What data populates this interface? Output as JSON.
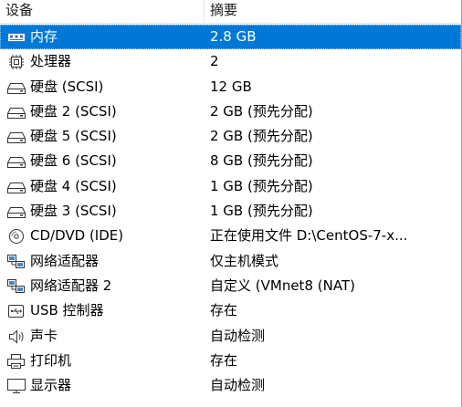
{
  "header": {
    "device": "设备",
    "summary": "摘要"
  },
  "rows": [
    {
      "device": "内存",
      "summary": "2.8 GB",
      "icon": "memory-icon",
      "selected": true
    },
    {
      "device": "处理器",
      "summary": "2",
      "icon": "cpu-icon"
    },
    {
      "device": "硬盘 (SCSI)",
      "summary": "12 GB",
      "icon": "hard-disk-icon"
    },
    {
      "device": "硬盘 2 (SCSI)",
      "summary": "2 GB (预先分配)",
      "icon": "hard-disk-icon"
    },
    {
      "device": "硬盘 5 (SCSI)",
      "summary": "2 GB (预先分配)",
      "icon": "hard-disk-icon"
    },
    {
      "device": "硬盘 6 (SCSI)",
      "summary": "8 GB (预先分配)",
      "icon": "hard-disk-icon"
    },
    {
      "device": "硬盘 4 (SCSI)",
      "summary": "1 GB (预先分配)",
      "icon": "hard-disk-icon"
    },
    {
      "device": "硬盘 3 (SCSI)",
      "summary": "1 GB (预先分配)",
      "icon": "hard-disk-icon"
    },
    {
      "device": "CD/DVD (IDE)",
      "summary": "正在使用文件 D:\\CentOS-7-x...",
      "icon": "cd-dvd-icon"
    },
    {
      "device": "网络适配器",
      "summary": "仅主机模式",
      "icon": "network-adapter-icon"
    },
    {
      "device": "网络适配器 2",
      "summary": "自定义 (VMnet8 (NAT)",
      "icon": "network-adapter-icon"
    },
    {
      "device": "USB 控制器",
      "summary": "存在",
      "icon": "usb-icon"
    },
    {
      "device": "声卡",
      "summary": "自动检测",
      "icon": "speaker-icon"
    },
    {
      "device": "打印机",
      "summary": "存在",
      "icon": "printer-icon"
    },
    {
      "device": "显示器",
      "summary": "自动检测",
      "icon": "display-icon"
    }
  ],
  "colors": {
    "selection": "#0078d7",
    "selection_text": "#ffffff"
  }
}
